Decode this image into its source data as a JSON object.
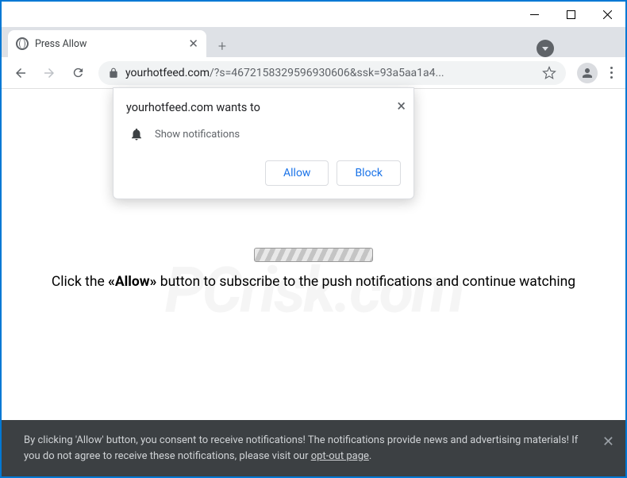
{
  "tab": {
    "title": "Press Allow"
  },
  "url": {
    "host": "yourhotfeed.com",
    "path": "/?s=4672158329596930606&ssk=93a5aa1a4..."
  },
  "permission": {
    "title": "yourhotfeed.com wants to",
    "body": "Show notifications",
    "allow": "Allow",
    "block": "Block"
  },
  "page": {
    "instruction_pre": "Click the ",
    "instruction_bold": "«Allow»",
    "instruction_post": " button to subscribe to the push notifications and continue watching"
  },
  "footer": {
    "text_pre": "By clicking 'Allow' button, you consent to receive notifications! The notifications provide news and advertising materials! If you do not agree to receive these notifications, please visit our ",
    "link": "opt-out page",
    "text_post": "."
  },
  "watermark": "PCrisk.com"
}
